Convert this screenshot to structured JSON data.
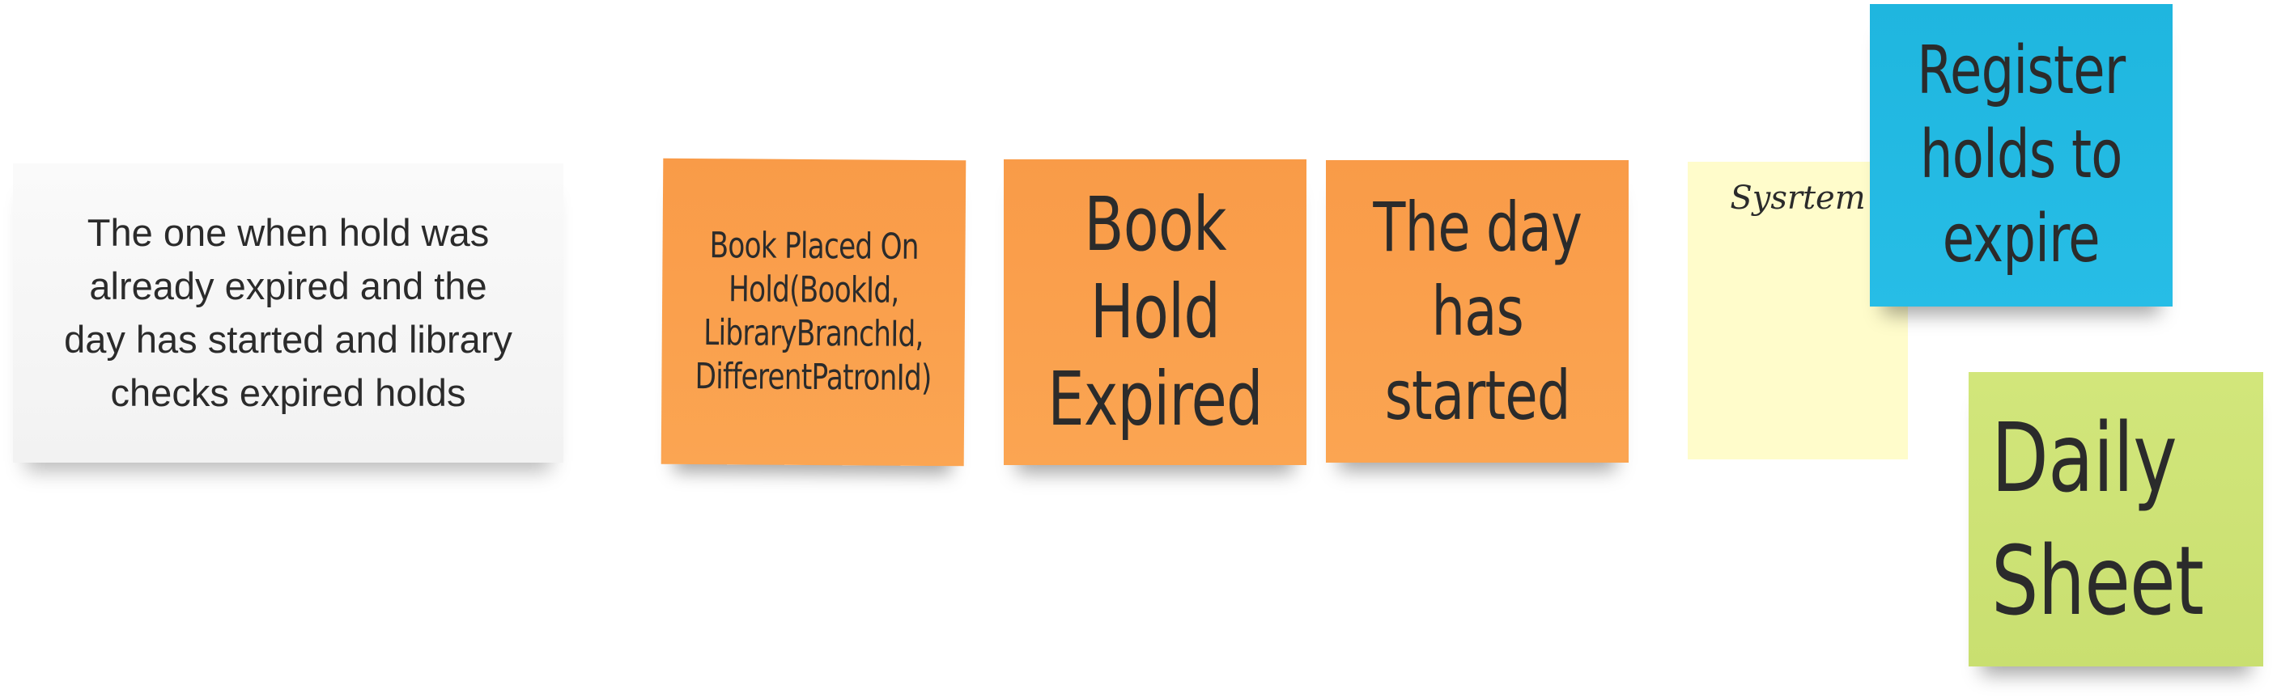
{
  "notes": {
    "description": {
      "text": "The one when hold was\nalready expired and the\nday has started and library\nchecks expired holds",
      "color": "#f6f6f6"
    },
    "command": {
      "text": "Book Placed On\nHold(BookId,\nLibraryBranchId,\nDifferentPatronId)",
      "color": "#fa9f4c"
    },
    "event": {
      "text": "Book Hold\nExpired",
      "color": "#fa9f4c"
    },
    "time_trigger": {
      "text": "The day\nhas\nstarted",
      "color": "#fa9f4c"
    },
    "actor": {
      "text": "Sysrtem",
      "color": "#fffccb"
    },
    "policy": {
      "text": "Register\nholds to\nexpire",
      "color": "#22b9e2"
    },
    "read_model": {
      "text": "Daily\nSheet",
      "color": "#cde274"
    }
  }
}
